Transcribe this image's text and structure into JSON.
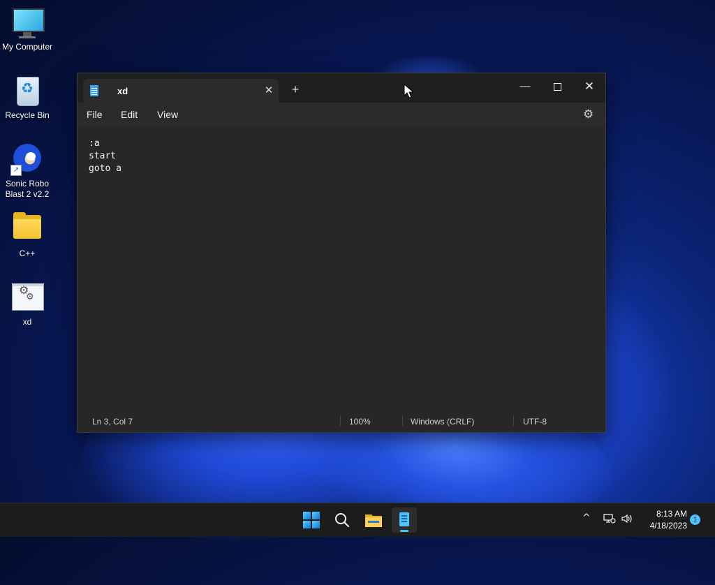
{
  "desktop": {
    "icons": [
      {
        "label": "My Computer",
        "icon": "computer-icon"
      },
      {
        "label": "Recycle Bin",
        "icon": "recycle-bin-icon"
      },
      {
        "label": "Sonic Robo Blast 2 v2.2",
        "icon": "sonic-icon"
      },
      {
        "label": "C++",
        "icon": "folder-icon"
      },
      {
        "label": "xd",
        "icon": "batch-file-icon"
      }
    ]
  },
  "notepad": {
    "tab_title": "xd",
    "tab_close_glyph": "✕",
    "new_tab_glyph": "+",
    "window_controls": {
      "minimize": "—",
      "close": "✕"
    },
    "menu": {
      "file": "File",
      "edit": "Edit",
      "view": "View"
    },
    "settings_glyph": "⚙",
    "content_lines": [
      ":a",
      "start",
      "goto a"
    ],
    "status": {
      "position": "Ln 3, Col 7",
      "zoom": "100%",
      "line_endings": "Windows (CRLF)",
      "encoding": "UTF-8"
    }
  },
  "taskbar": {
    "tray_chevron": "^",
    "time": "8:13 AM",
    "date": "4/18/2023",
    "notification_count": "1"
  },
  "colors": {
    "accent": "#4cc2ff",
    "window_bg": "#272727",
    "titlebar_bg": "#1f1f1f",
    "taskbar_bg": "#1c1c1c"
  }
}
